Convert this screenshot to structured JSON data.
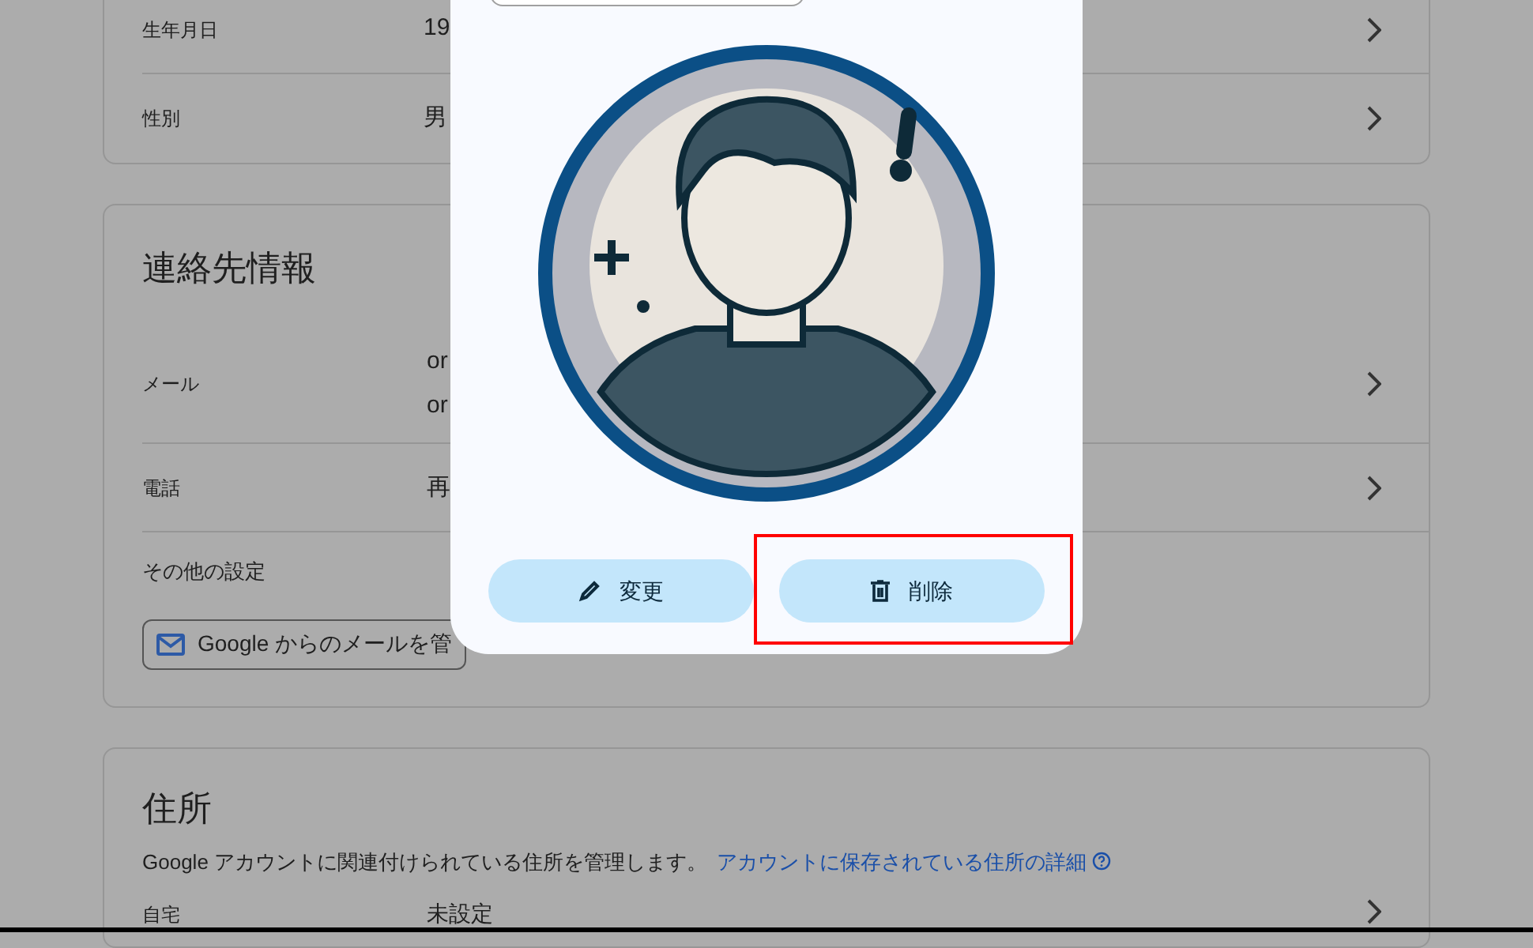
{
  "profile_card": {
    "rows": [
      {
        "label": "生年月日",
        "value": "19"
      },
      {
        "label": "性別",
        "value": "男"
      }
    ]
  },
  "contact_card": {
    "title": "連絡先情報",
    "rows": [
      {
        "label": "メール",
        "values": [
          "or",
          "or"
        ]
      },
      {
        "label": "電話",
        "values": [
          "再"
        ]
      }
    ],
    "other_settings": {
      "label": "その他の設定",
      "button": "Google からのメールを管"
    }
  },
  "address_card": {
    "title": "住所",
    "description": "Google アカウントに関連付けられている住所を管理します。",
    "link": "アカウントに保存されている住所の詳細",
    "rows": [
      {
        "label": "自宅",
        "value": "未設定"
      }
    ]
  },
  "dialog": {
    "buttons": [
      {
        "kind": "edit",
        "label": "変更",
        "highlighted": false
      },
      {
        "kind": "delete",
        "label": "削除",
        "highlighted": true
      }
    ]
  }
}
